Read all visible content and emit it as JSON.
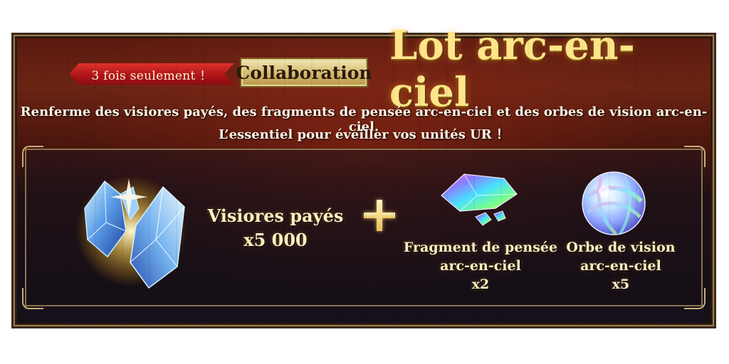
{
  "banner": {
    "ribbon_label": "3 fois seulement ！",
    "collab_label": "Collaboration",
    "title": "Lot arc-en-ciel",
    "description_line1": "Renferme des visiores payés, des fragments de pensée arc-en-ciel et des orbes de vision arc-en-ciel.",
    "description_line2": "L’essentiel pour éveiller vos unités UR ！"
  },
  "rewards": [
    {
      "icon": "crystals-icon",
      "name": "Visiores payés",
      "quantity": "x5 000"
    },
    {
      "icon": "fragment-icon",
      "name_line1": "Fragment de pensée",
      "name_line2": "arc-en-ciel",
      "quantity": "x2"
    },
    {
      "icon": "orb-icon",
      "name_line1": "Orbe de vision",
      "name_line2": "arc-en-ciel",
      "quantity": "x5"
    }
  ],
  "colors": {
    "title_gold": "#ffe58a",
    "ribbon_red": "#b01619",
    "panel_border": "#8a7350"
  }
}
